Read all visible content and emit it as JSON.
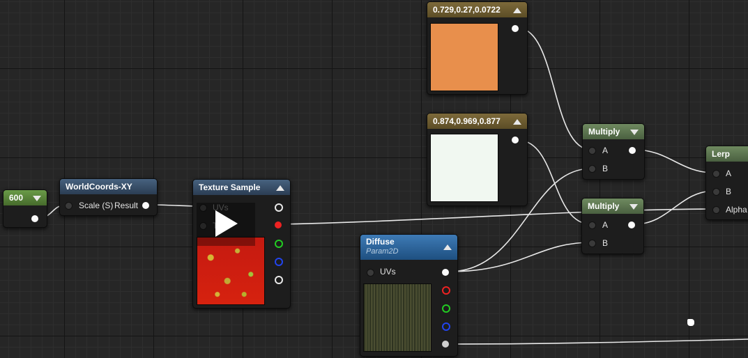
{
  "colors": {
    "orange_swatch": "#e88f4c",
    "white_swatch": "#f1f8f1",
    "wire": "#e8e8e8",
    "pin_red": "#ee2222",
    "pin_green": "#22cc22",
    "pin_blue": "#2244ee"
  },
  "nodes": {
    "const600": {
      "value": "600"
    },
    "worldcoords": {
      "title": "WorldCoords-XY",
      "input_label": "Scale (S)",
      "output_label": "Result"
    },
    "texture_sample": {
      "title": "Texture Sample",
      "input_uvs": "UVs",
      "input_tex": "T"
    },
    "color1": {
      "title": "0.729,0.27,0.0722"
    },
    "color2": {
      "title": "0.874,0.969,0.877"
    },
    "multiply1": {
      "title": "Multiply",
      "input_a": "A",
      "input_b": "B"
    },
    "multiply2": {
      "title": "Multiply",
      "input_a": "A",
      "input_b": "B"
    },
    "lerp": {
      "title": "Lerp",
      "input_a": "A",
      "input_b": "B",
      "input_alpha": "Alpha"
    },
    "diffuse": {
      "title": "Diffuse",
      "subtitle": "Param2D",
      "input_uvs": "UVs"
    }
  },
  "icons": [
    "collapse-arrow-icon",
    "play-icon",
    "hand-cursor-icon"
  ]
}
